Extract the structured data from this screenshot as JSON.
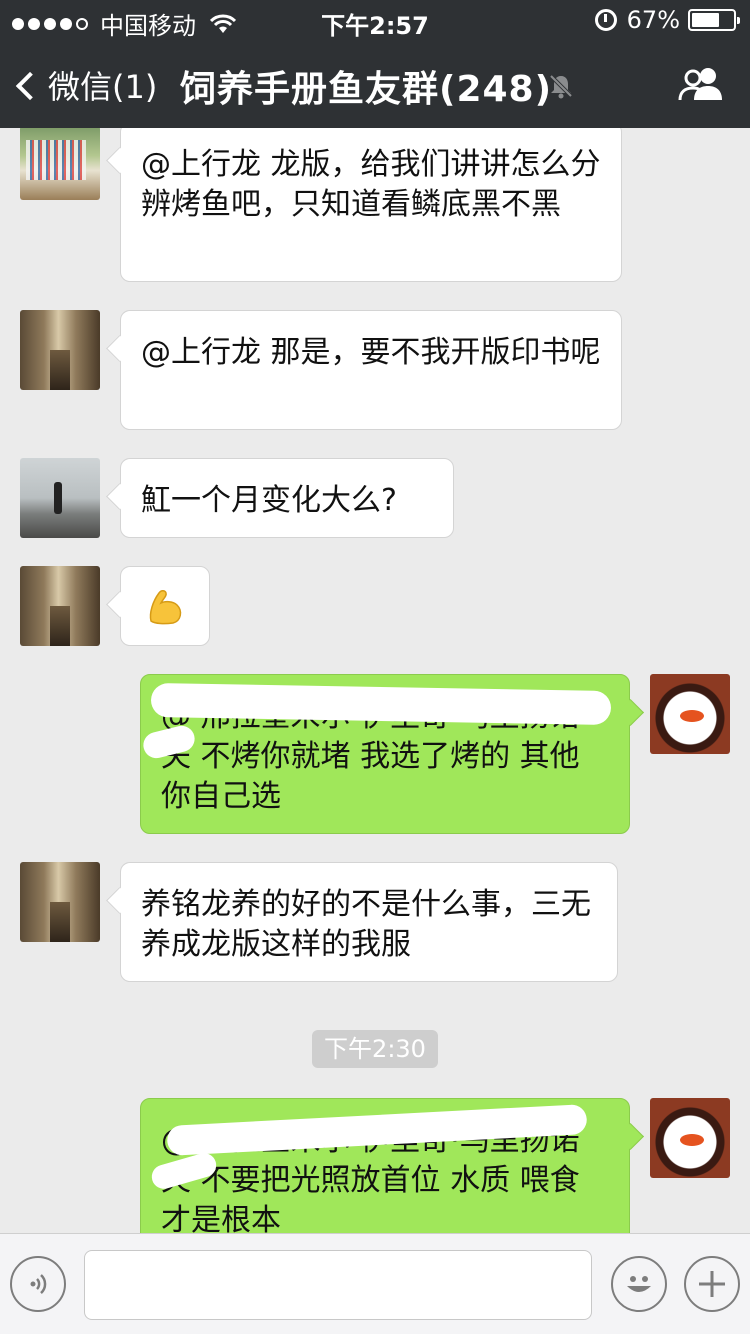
{
  "status_bar": {
    "carrier": "中国移动",
    "time": "下午2:57",
    "battery_percent": "67%",
    "battery_level": 0.67,
    "signal_bars": 4
  },
  "nav": {
    "back_label": "微信(1)",
    "title": "饲养手册鱼友群(248)",
    "icons": {
      "back": "chevron-left-icon",
      "mute": "mute-bell-icon",
      "group": "group-members-icon"
    }
  },
  "messages": [
    {
      "side": "in",
      "avatar": "garden-avatar",
      "text": "@上行龙 龙版，给我们讲讲怎么分辨烤鱼吧，只知道看鳞底黑不黑"
    },
    {
      "side": "in",
      "avatar": "street-avatar",
      "text": "@上行龙 那是，要不我开版印书呢"
    },
    {
      "side": "in",
      "avatar": "beach-avatar",
      "text": "魟一个月变化大么?"
    },
    {
      "side": "in",
      "avatar": "street-avatar",
      "text": "",
      "emoji": "flexed-biceps-emoji"
    },
    {
      "side": "out",
      "avatar": "arowana-avatar",
      "text": "@ 邢拉奎米尔·伊里奇·乌里扬诺夫 不烤你就堵 我选了烤的 其他你自己选",
      "redacted": true
    },
    {
      "side": "in",
      "avatar": "street-avatar",
      "text": "养铭龙养的好的不是什么事，三无养成龙版这样的我服"
    },
    {
      "side": "out",
      "avatar": "arowana-avatar",
      "text": "@ 邢拉奎米尔·伊里奇·乌里扬诺夫 不要把光照放首位 水质 喂食才是根本",
      "redacted": true
    }
  ],
  "timestamp": "下午2:30",
  "input_bar": {
    "icons": {
      "voice": "voice-icon",
      "emoji": "emoji-smile-icon",
      "more": "plus-icon"
    },
    "placeholder": ""
  }
}
